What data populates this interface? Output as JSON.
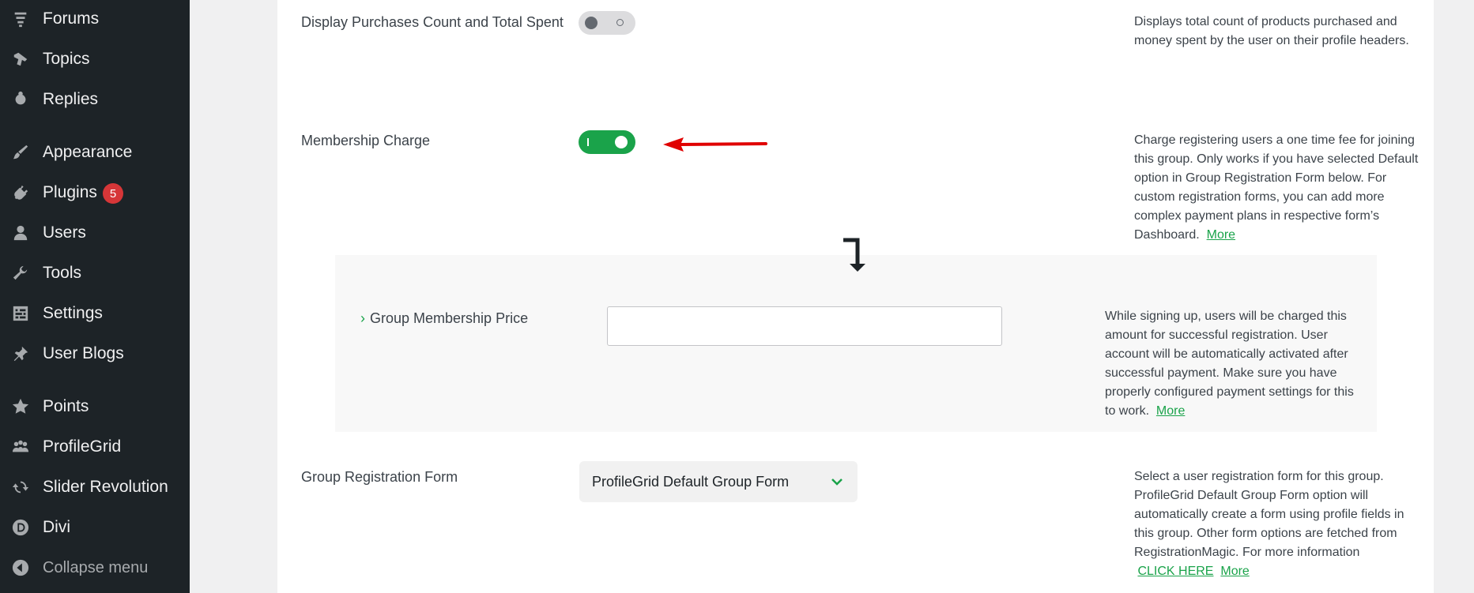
{
  "sidebar": {
    "items": [
      {
        "label": "Forums",
        "icon": "forums-icon"
      },
      {
        "label": "Topics",
        "icon": "topics-icon"
      },
      {
        "label": "Replies",
        "icon": "replies-icon"
      },
      {
        "label": "Appearance",
        "icon": "paint-brush-icon"
      },
      {
        "label": "Plugins",
        "icon": "plug-icon",
        "badge": "5"
      },
      {
        "label": "Users",
        "icon": "user-icon"
      },
      {
        "label": "Tools",
        "icon": "wrench-icon"
      },
      {
        "label": "Settings",
        "icon": "settings-icon"
      },
      {
        "label": "User Blogs",
        "icon": "pushpin-icon"
      },
      {
        "label": "Points",
        "icon": "star-icon"
      },
      {
        "label": "ProfileGrid",
        "icon": "groups-icon"
      },
      {
        "label": "Slider Revolution",
        "icon": "refresh-icon"
      },
      {
        "label": "Divi",
        "icon": "divi-logo-icon"
      },
      {
        "label": "Collapse menu",
        "icon": "collapse-icon"
      }
    ]
  },
  "settings": {
    "purchases": {
      "label": "Display Purchases Count and Total Spent",
      "enabled": false,
      "description": "Displays total count of products purchased and money spent by the user on their profile headers."
    },
    "membership": {
      "label": "Membership Charge",
      "enabled": true,
      "description": "Charge registering users a one time fee for joining this group. Only works if you have selected Default option in Group Registration Form below. For custom registration forms, you can add more complex payment plans in respective form’s Dashboard.",
      "more": "More"
    },
    "price": {
      "chevron": "›",
      "label": "Group Membership Price",
      "value": "",
      "placeholder": "",
      "description": "While signing up, users will be charged this amount for successful registration. User account will be automatically activated after successful payment. Make sure you have properly configured payment settings for this to work.",
      "more": "More"
    },
    "registration": {
      "label": "Group Registration Form",
      "selected": "ProfileGrid Default Group Form",
      "description": "Select a user registration form for this group. ProfileGrid Default Group Form option will automatically create a form using profile fields in this group. Other form options are fetched from RegistrationMagic. For more information",
      "click_here": "CLICK HERE",
      "more": "More"
    }
  },
  "colors": {
    "sidebar_bg": "#1d2327",
    "accent_green": "#1aa34a",
    "badge_red": "#d63638",
    "annotation_red": "#e00000"
  }
}
